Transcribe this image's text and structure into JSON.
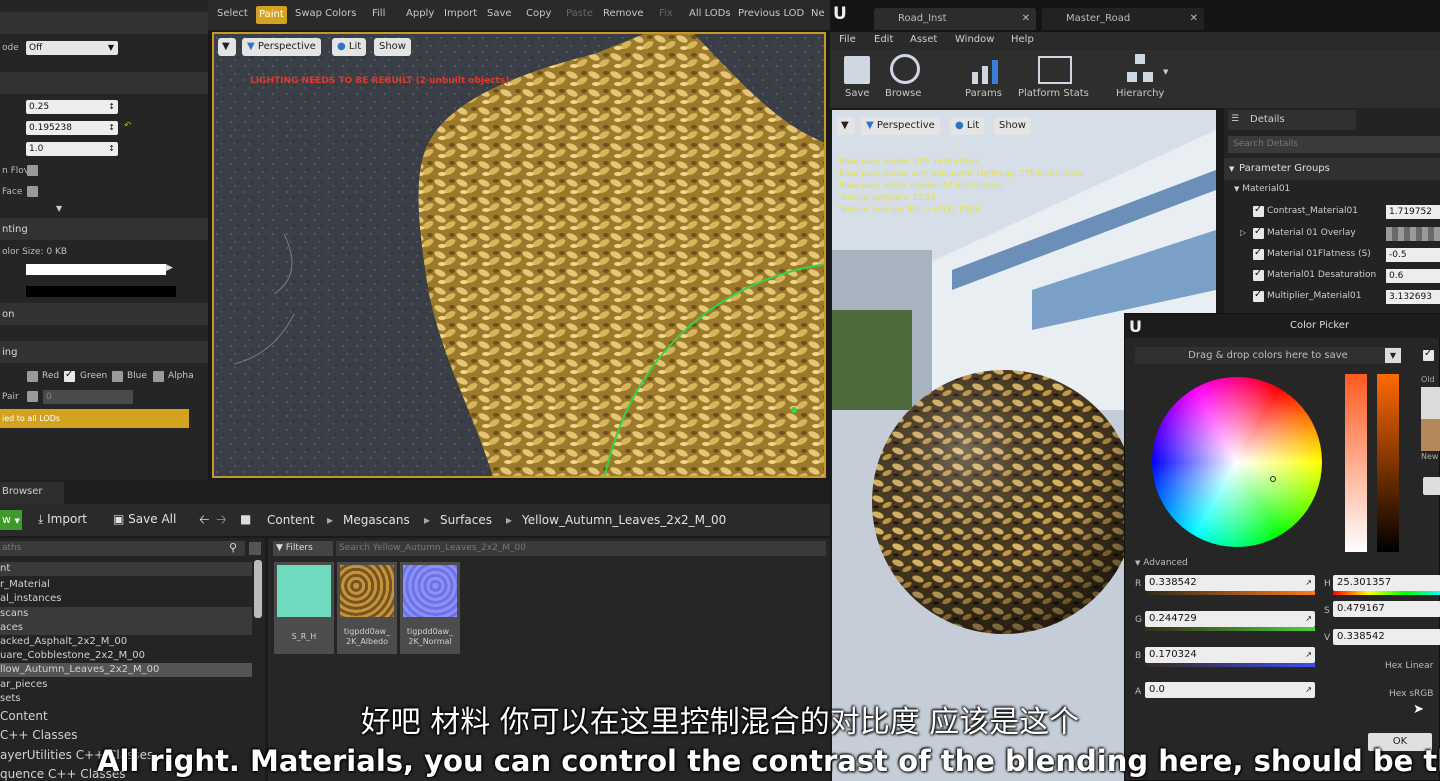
{
  "left_panel": {
    "mode_dropdown": "Off",
    "mode_label": "ode",
    "value_1": "0.25",
    "value_2": "0.195238",
    "value_3": "1.0",
    "check_label_1": "n Flov",
    "check_label_2": "Face",
    "section_painting": "nting",
    "color_size_label": "olor Size: 0 KB",
    "section_on": "on",
    "section_ing": "ing",
    "channels": [
      "Red",
      "Green",
      "Blue",
      "Alpha"
    ],
    "pair_label": "Pair",
    "pair_value": "0",
    "apply_lods_label": "ied to all LODs"
  },
  "top_toolbar": {
    "items": [
      "Select",
      "Paint",
      "Swap Colors",
      "Fill",
      "Apply",
      "Import",
      "Save",
      "Copy",
      "Paste",
      "Remove",
      "Fix",
      "All LODs",
      "Previous LOD",
      "Ne"
    ]
  },
  "viewport1": {
    "perspective_label": "Perspective",
    "lit_label": "Lit",
    "show_label": "Show",
    "warning": "LIGHTING NEEDS TO BE REBUILT (2 unbuilt objects)"
  },
  "content_browser": {
    "tab_label": "Browser",
    "add_new_label": "w",
    "import_label": "Import",
    "save_all_label": "Save All",
    "breadcrumb": [
      "Content",
      "Megascans",
      "Surfaces",
      "Yellow_Autumn_Leaves_2x2_M_00"
    ],
    "search_paths_placeholder": "aths",
    "filters_label": "Filters",
    "search_assets_placeholder": "Search Yellow_Autumn_Leaves_2x2_M_00",
    "tree_items": [
      "nt",
      "r_Material",
      "al_instances",
      "scans",
      "aces",
      "acked_Asphalt_2x2_M_00",
      "uare_Cobblestone_2x2_M_00",
      "llow_Autumn_Leaves_2x2_M_00",
      "ar_pieces",
      "sets",
      "Content",
      "C++ Classes",
      "ayerUtilities C++ Classes",
      "quence C++ Classes"
    ],
    "assets": [
      {
        "name": "S_R_H",
        "color": "#6fdcbf"
      },
      {
        "name": "tigpdd0aw_ 2K_Albedo",
        "color": "#a67a2e"
      },
      {
        "name": "tigpdd0aw_ 2K_Normal",
        "color": "#7f86f2"
      }
    ]
  },
  "material_editor": {
    "tabs": [
      "Road_Inst",
      "Master_Road"
    ],
    "menu": [
      "File",
      "Edit",
      "Asset",
      "Window",
      "Help"
    ],
    "tools": [
      "Save",
      "Browse",
      "Params",
      "Platform Stats",
      "Hierarchy"
    ],
    "perspective_label": "Perspective",
    "lit_label": "Lit",
    "show_label": "Show",
    "stats": [
      "Base pass shader: 205 instructions",
      "Base pass shader with Volumetric Lightmap: 279 instructions",
      "Base pass vertex shader: 47 instructions",
      "Texture samplers: 12/16",
      "Texture Lookups (Est.): VS(3), PS(9)"
    ]
  },
  "details": {
    "tab_label": "Details",
    "search_placeholder": "Search Details",
    "group_header": "Parameter Groups",
    "subgroup": "Material01",
    "params": [
      {
        "label": "Contrast_Material01",
        "value": "1.719752",
        "checked": true
      },
      {
        "label": "Material 01 Overlay",
        "value": "",
        "checked": true
      },
      {
        "label": "Material 01Flatness (S)",
        "value": "-0.5",
        "checked": true
      },
      {
        "label": "Material01 Desaturation",
        "value": "0.6",
        "checked": true
      },
      {
        "label": "Multiplier_Material01",
        "value": "3.132693",
        "checked": true
      }
    ]
  },
  "color_picker": {
    "title": "Color Picker",
    "drop_zone_label": "Drag & drop colors here to save",
    "old_label": "Old",
    "new_label": "New",
    "advanced_label": "Advanced",
    "r_value": "0.338542",
    "g_value": "0.244729",
    "b_value": "0.170324",
    "a_value": "0.0",
    "h_value": "25.301357",
    "s_value": "0.479167",
    "v_value": "0.338542",
    "hex_linear_label": "Hex Linear",
    "hex_srgb_label": "Hex sRGB",
    "ok_label": "OK",
    "accent": "#b4885a"
  },
  "subtitles": {
    "chinese": "好吧 材料 你可以在这里控制混合的对比度 应该是这个",
    "english": "All right. Materials, you can control the contrast of the blending here, should be this one"
  }
}
